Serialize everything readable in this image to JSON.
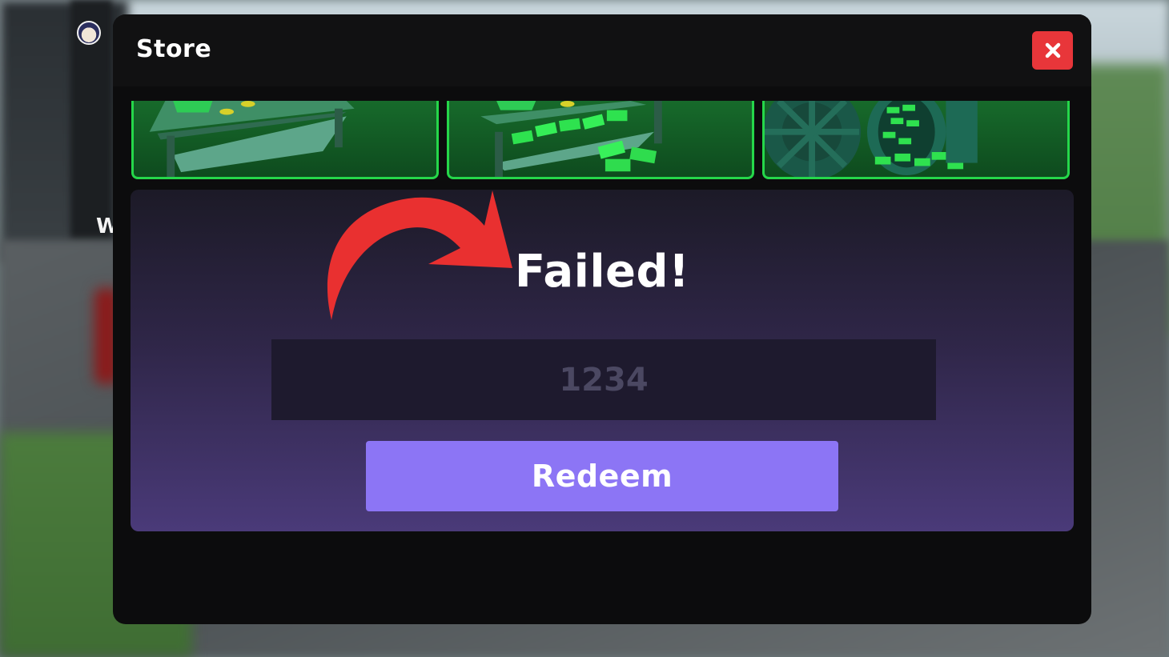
{
  "store": {
    "title": "Store",
    "close_icon": "close-icon"
  },
  "background": {
    "partial_text": "W"
  },
  "products": [
    {
      "name": "money-table-coins",
      "icon": "table-icon"
    },
    {
      "name": "money-table-cash",
      "icon": "cash-stack-icon"
    },
    {
      "name": "vault",
      "icon": "vault-icon"
    }
  ],
  "redeem_panel": {
    "status": "Failed!",
    "code_placeholder": "1234",
    "redeem_label": "Redeem"
  },
  "colors": {
    "close_button": "#e8363a",
    "redeem_button": "#8c75f5",
    "card_border": "#25d74a",
    "arrow": "#e93030"
  }
}
